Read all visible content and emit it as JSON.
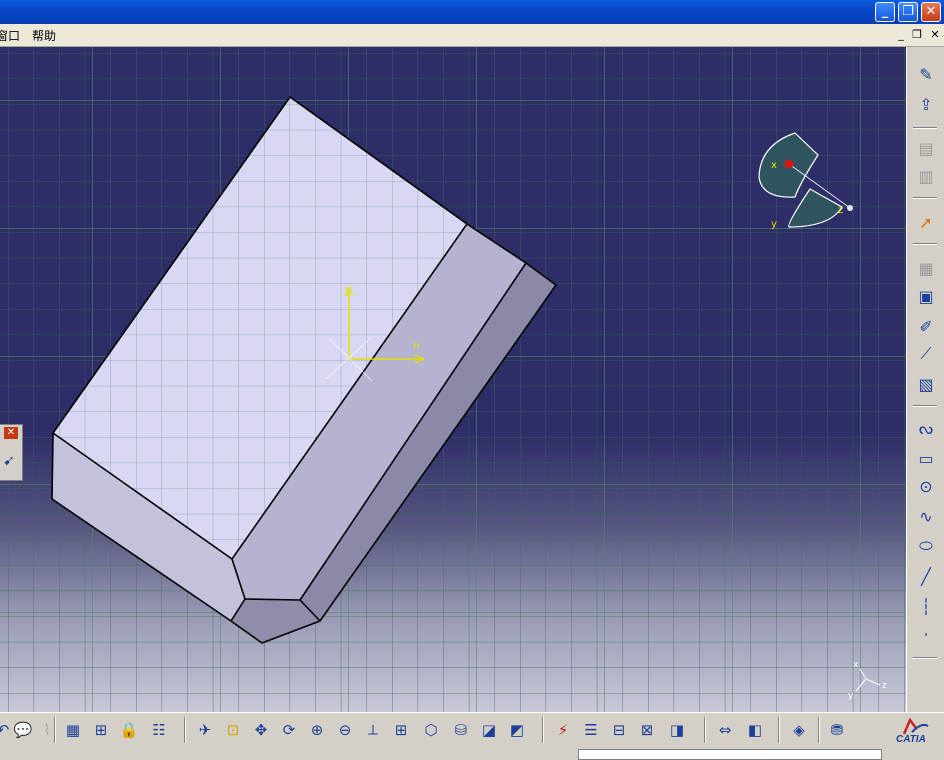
{
  "window": {
    "minimize": "_",
    "restore": "❐",
    "close": "✕"
  },
  "menubar": {
    "items": [
      "窗口",
      "帮助"
    ],
    "mdi_minimize": "_",
    "mdi_restore": "❐",
    "mdi_close": "✕"
  },
  "viewport": {
    "axis_h_label": "H",
    "axis_v_label": "V",
    "compass_x": "x",
    "compass_y": "y",
    "compass_z": "z",
    "triad_x": "x",
    "triad_y": "y",
    "triad_z": "z"
  },
  "float_panel": {
    "close": "✕",
    "icon": "select-icon"
  },
  "right_toolbar": {
    "icons": [
      "sketcher-exit-icon",
      "exit-workbench-icon",
      "cut-part-icon",
      "grid-icon",
      "select-arrow-icon",
      "snap-icon",
      "construction-element-icon",
      "edit-icon",
      "constraint-icon",
      "auto-constraint-icon",
      "profile-icon",
      "rectangle-icon",
      "circle-icon",
      "spline-icon",
      "ellipse-icon",
      "line-icon",
      "axis-icon",
      "point-icon"
    ]
  },
  "bottom_toolbar": {
    "icons": [
      "undo-icon",
      "comment-icon",
      "redo-icon",
      "table-icon",
      "tree-icon",
      "lock-icon",
      "catalog-icon",
      "fly-icon",
      "fit-all-icon",
      "pan-icon",
      "rotate-icon",
      "zoom-in-icon",
      "zoom-out-icon",
      "normal-view-icon",
      "multi-view-icon",
      "iso-view-icon",
      "render-style-icon",
      "hide-show-icon",
      "swap-icon",
      "sketch-analysis-icon",
      "ruler-icon",
      "constraint-display-icon",
      "geometry-icon",
      "dimension-icon",
      "measure-icon",
      "visualization-icon",
      "texture-icon",
      "apply-material-icon"
    ],
    "logo_text": "CATIA"
  }
}
